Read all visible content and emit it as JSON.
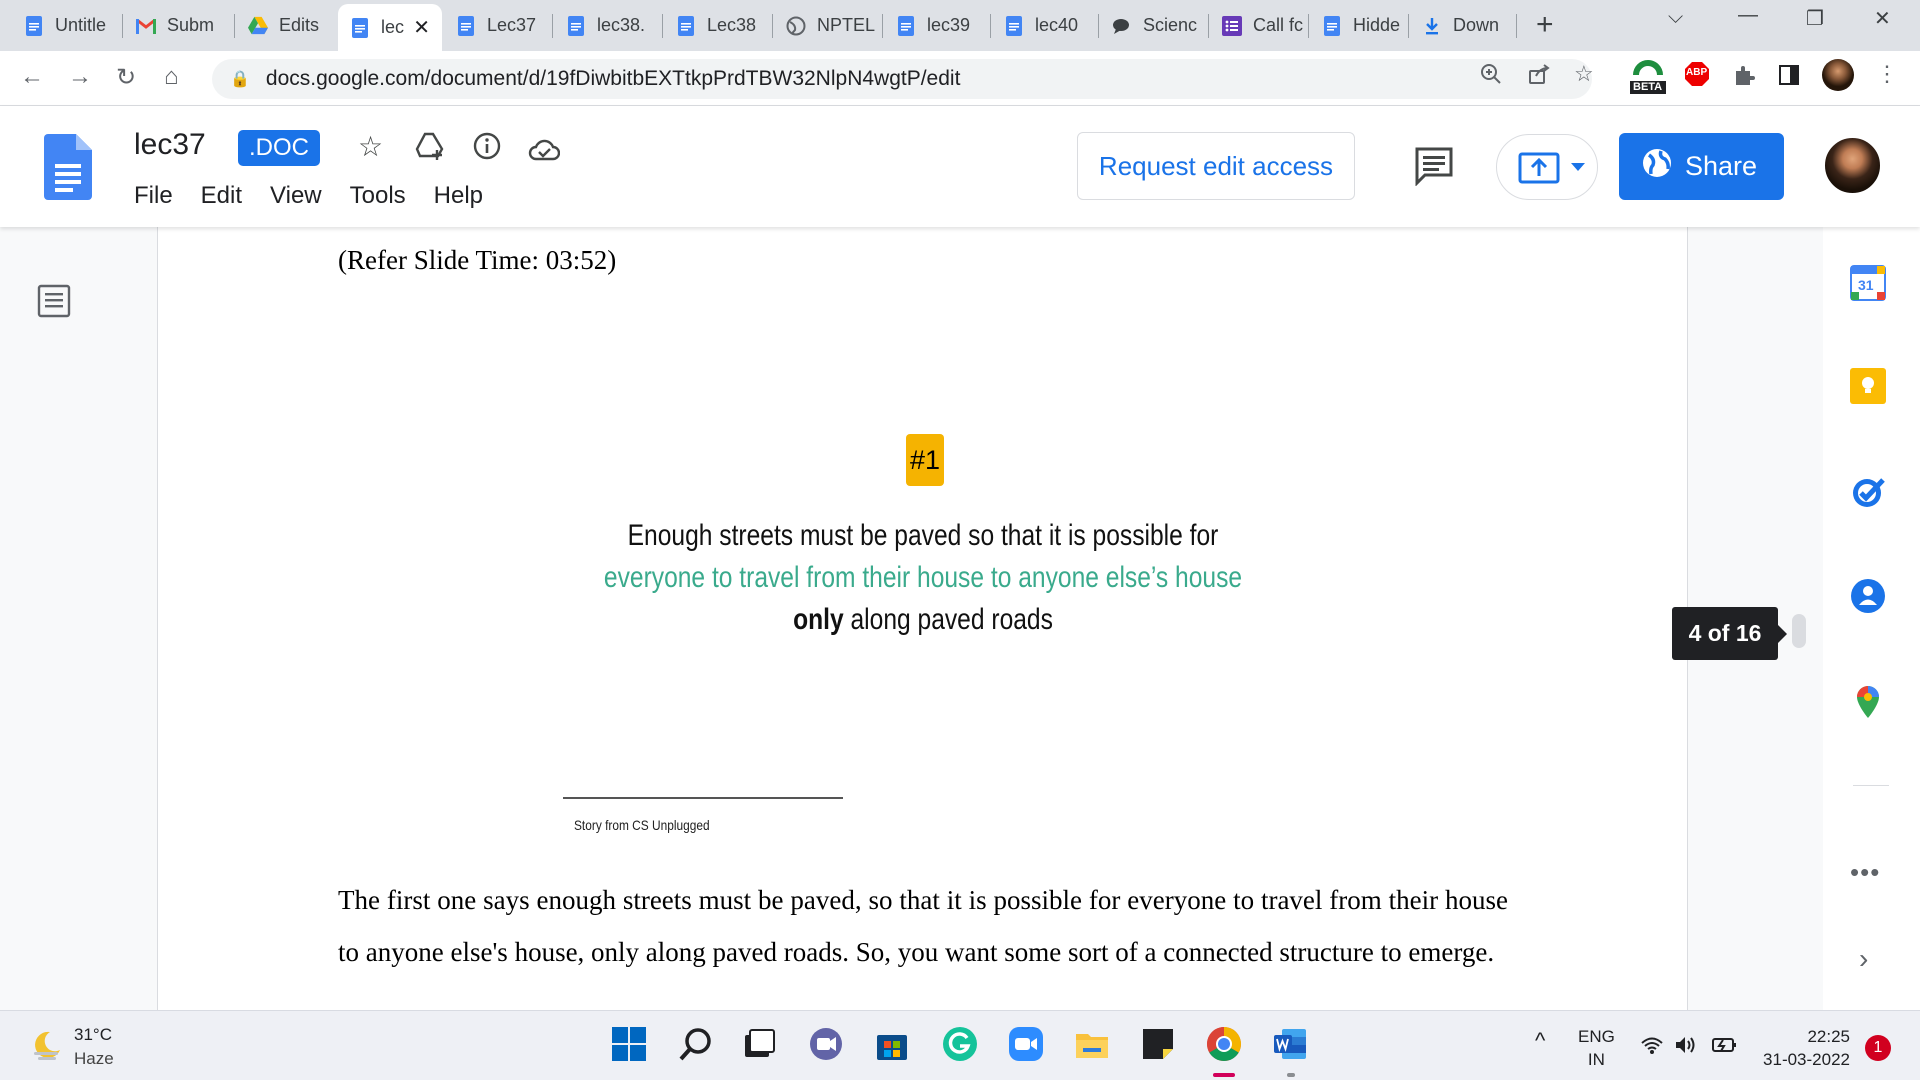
{
  "browser": {
    "tabs": [
      {
        "title": "Untitle",
        "icon": "docs-icon"
      },
      {
        "title": "Subm",
        "icon": "gmail-icon"
      },
      {
        "title": "Edits",
        "icon": "drive-icon"
      },
      {
        "title": "lec",
        "icon": "docs-icon",
        "active": true
      },
      {
        "title": "Lec37",
        "icon": "docs-icon"
      },
      {
        "title": "lec38.",
        "icon": "docs-icon"
      },
      {
        "title": "Lec38",
        "icon": "docs-icon"
      },
      {
        "title": "NPTEL",
        "icon": "globe-icon"
      },
      {
        "title": "lec39",
        "icon": "docs-icon"
      },
      {
        "title": "lec40",
        "icon": "docs-icon"
      },
      {
        "title": "Scienc",
        "icon": "chat-icon"
      },
      {
        "title": "Call fc",
        "icon": "forms-icon"
      },
      {
        "title": "Hidde",
        "icon": "docs-icon"
      },
      {
        "title": "Down",
        "icon": "download-icon"
      }
    ],
    "url": "docs.google.com/document/d/19fDiwbitbEXTtkpPrdTBW32NlpN4wgtP/edit",
    "ext_beta": "BETA",
    "ext_abp": "ABP"
  },
  "docs": {
    "title": "lec37",
    "badge": ".DOC",
    "menu": [
      "File",
      "Edit",
      "View",
      "Tools",
      "Help"
    ],
    "request_edit": "Request edit access",
    "share": "Share"
  },
  "document": {
    "refer": "(Refer Slide Time: 03:52)",
    "slide_tag": "#1",
    "slide_line1": "Enough streets must be paved so that it is possible for",
    "slide_line2": "everyone to travel from their house to anyone else’s house",
    "slide_line3_bold": "only",
    "slide_line3_rest": " along paved roads",
    "slide_caption": "Story from CS Unplugged",
    "body": "The first one says enough streets must be paved, so that it is possible for everyone to travel from their house to anyone else's house, only along paved roads. So, you want some sort of a connected structure to emerge.",
    "page_indicator": "4 of 16"
  },
  "side_panel": {
    "calendar_day": "31"
  },
  "taskbar": {
    "temp": "31°C",
    "weather": "Haze",
    "lang1": "ENG",
    "lang2": "IN",
    "time": "22:25",
    "date": "31-03-2022",
    "notifications": "1"
  },
  "colors": {
    "accent": "#1a73e8",
    "slide_green": "#3aaa8c",
    "slide_tag": "#f5b301"
  }
}
